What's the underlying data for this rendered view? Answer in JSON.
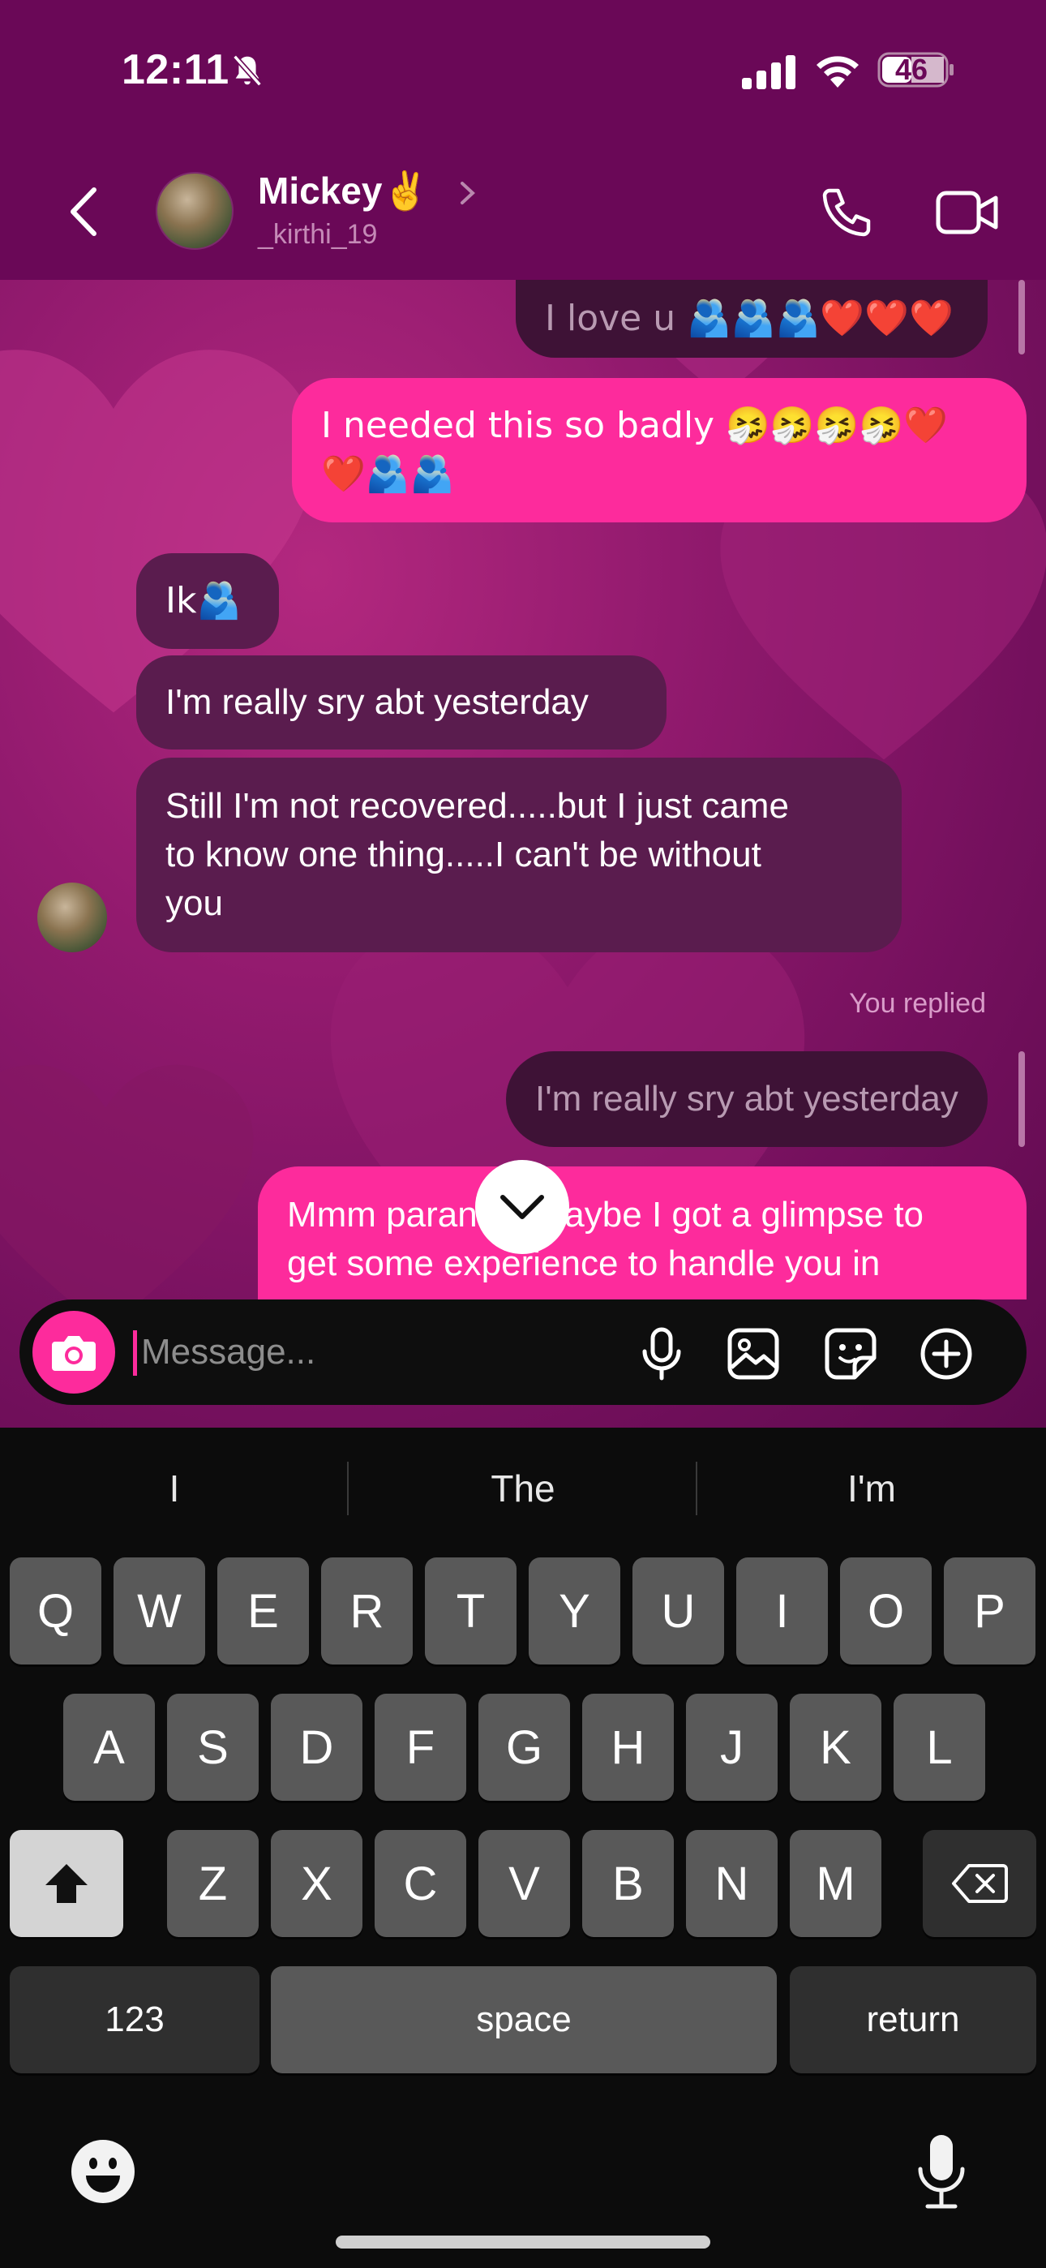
{
  "status_bar": {
    "time": "12:11",
    "battery": "46"
  },
  "header": {
    "name": "Mickey",
    "name_emoji": "✌️",
    "username": "_kirthi_19"
  },
  "messages": [
    {
      "id": "m1",
      "side": "reply",
      "text": "I love u 🫂🫂🫂❤️❤️❤️"
    },
    {
      "id": "m2",
      "side": "sent",
      "line1": "I needed this so badly 🤧🤧🤧🤧❤️",
      "line2": "❤️🫂🫂"
    },
    {
      "id": "m3",
      "side": "received",
      "text": "Ik🫂"
    },
    {
      "id": "m4",
      "side": "received",
      "text": "I'm really sry abt yesterday"
    },
    {
      "id": "m5",
      "side": "received",
      "line1": "Still I'm not recovered.....but I just came",
      "line2": "to know one thing.....I can't be without",
      "line3": "you"
    },
    {
      "id": "m6",
      "side": "reply",
      "label": "You replied",
      "text": "I'm really sry abt yesterday"
    },
    {
      "id": "m7",
      "side": "sent",
      "line1": "Mmm paranoid maybe I got a glimpse to",
      "line2": "get some experience to handle you in"
    }
  ],
  "composer": {
    "placeholder": "Message..."
  },
  "keyboard": {
    "suggestions": [
      "I",
      "The",
      "I'm"
    ],
    "row1": [
      "Q",
      "W",
      "E",
      "R",
      "T",
      "Y",
      "U",
      "I",
      "O",
      "P"
    ],
    "row2": [
      "A",
      "S",
      "D",
      "F",
      "G",
      "H",
      "J",
      "K",
      "L"
    ],
    "row3": [
      "Z",
      "X",
      "C",
      "V",
      "B",
      "N",
      "M"
    ],
    "numbers_label": "123",
    "space_label": "space",
    "return_label": "return"
  },
  "icons": {
    "bell": "bell-slash-icon",
    "signal": "cellular-signal-icon",
    "wifi": "wifi-icon",
    "back": "chevron-left-icon",
    "phone": "phone-icon",
    "video": "video-camera-icon",
    "camera": "camera-icon",
    "mic": "microphone-icon",
    "gallery": "image-icon",
    "sticker": "sticker-icon",
    "plus": "plus-circle-icon",
    "scroll": "chevron-down-icon",
    "shift": "shift-icon",
    "delete": "backspace-icon",
    "emoji": "emoji-icon",
    "dictation": "dictation-icon"
  },
  "colors": {
    "header_bg": "#6a0857",
    "sent_bubble": "#fd2b9c",
    "received_bubble": "#5a1c4e"
  }
}
